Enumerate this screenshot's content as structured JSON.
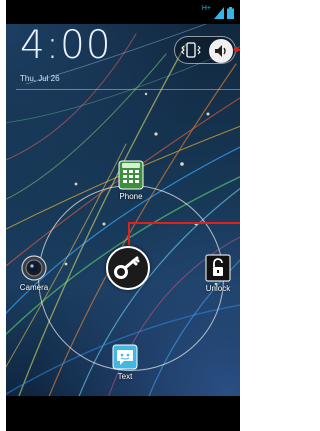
{
  "lockscreen": {
    "time": "4:00",
    "date": "Thu, Jul 26"
  },
  "status_bar": {
    "network_type": "H+",
    "icons": [
      "network-type-icon",
      "signal-icon",
      "battery-icon"
    ]
  },
  "sound_toggle": {
    "options": [
      "vibrate-icon",
      "speaker-icon"
    ],
    "selected": "speaker-icon"
  },
  "targets": {
    "phone": {
      "label": "Phone",
      "icon": "phone-dialpad-icon",
      "color": "#3b8f3e"
    },
    "camera": {
      "label": "Camera",
      "icon": "camera-icon"
    },
    "unlock": {
      "label": "Unlock",
      "icon": "padlock-icon"
    },
    "text": {
      "label": "Text",
      "icon": "message-bubble-icon",
      "color": "#3fb8e4"
    }
  },
  "unlock_handle": {
    "icon": "key-icon"
  },
  "colors": {
    "callout": "#e0201a",
    "accent_blue": "#33b5e5"
  }
}
